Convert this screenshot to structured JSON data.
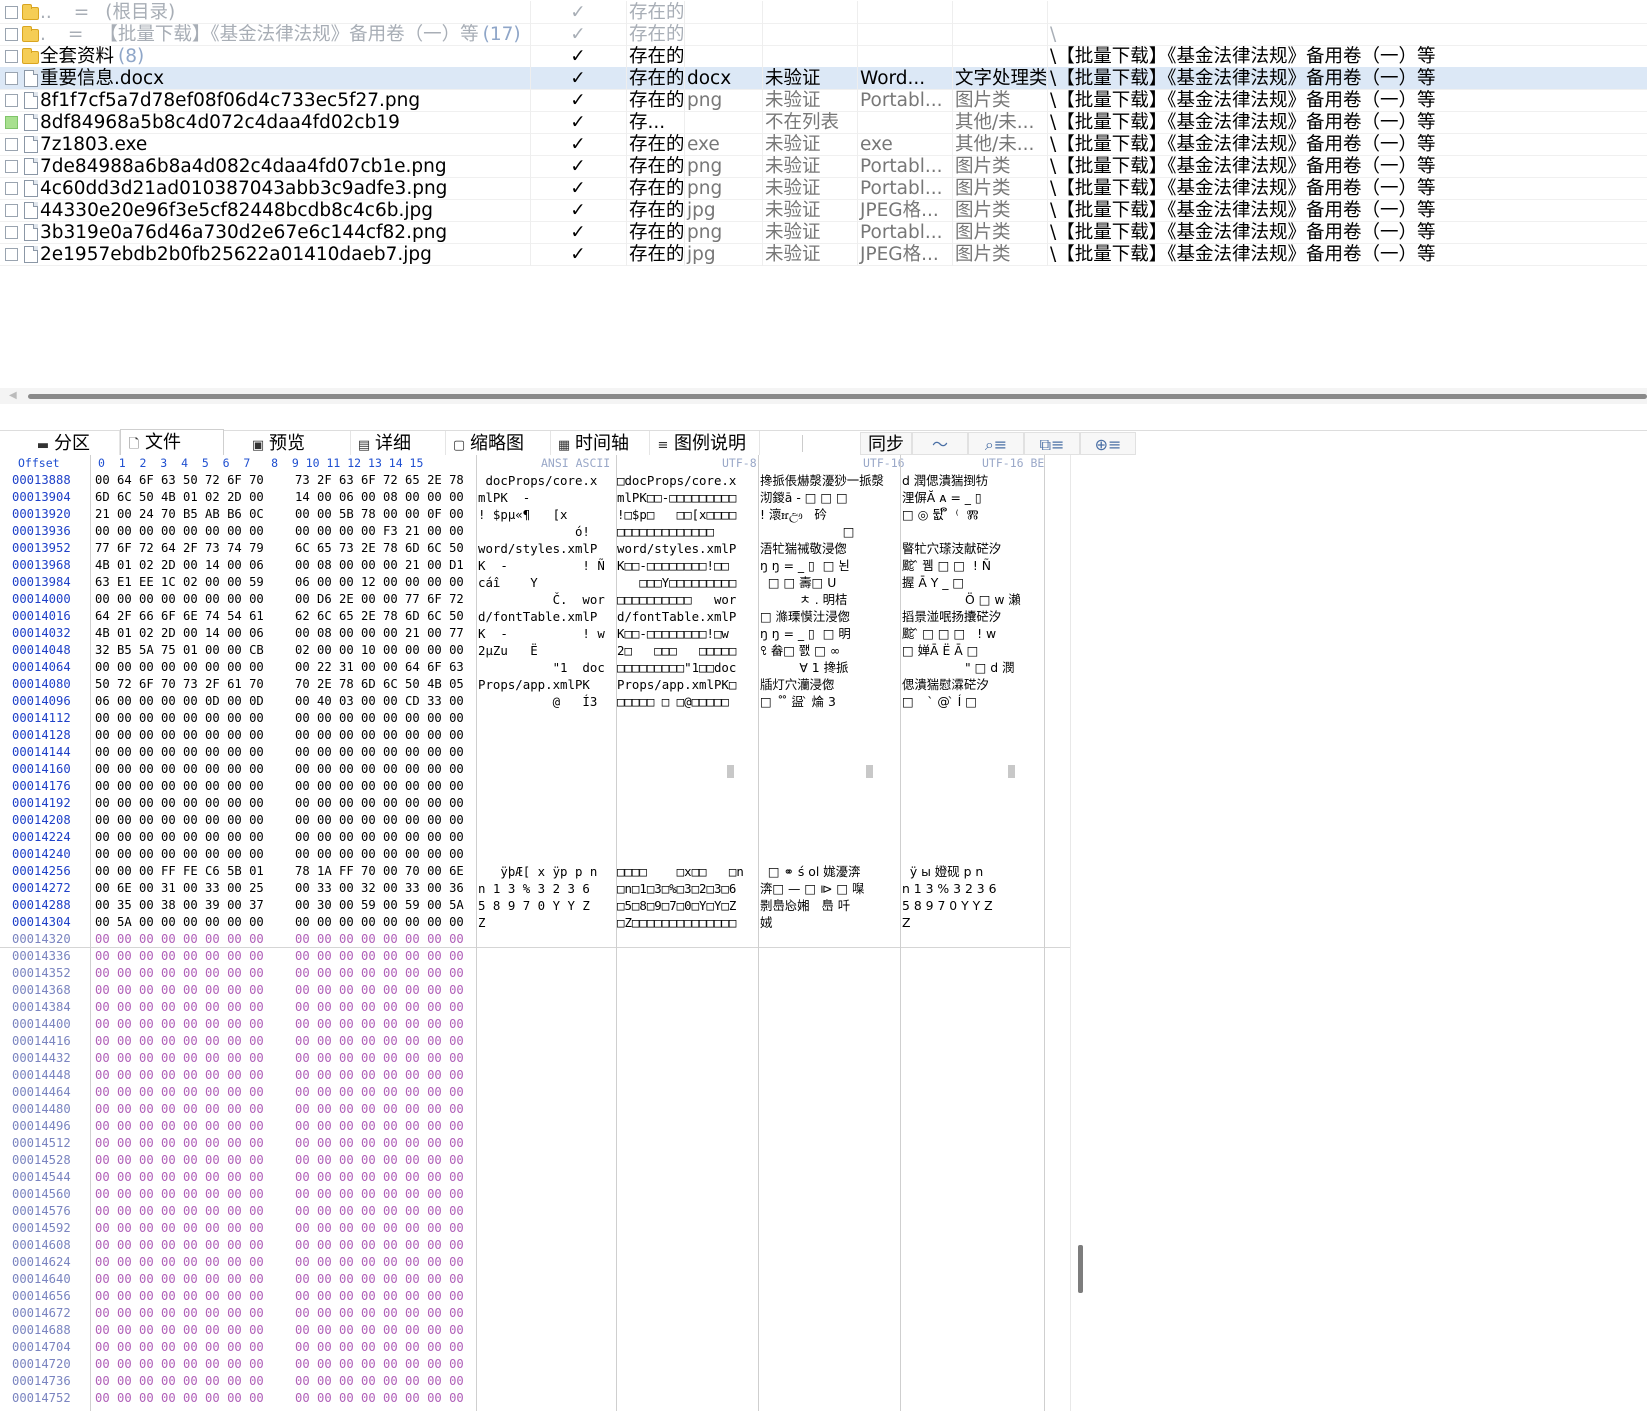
{
  "file_list": {
    "rows": [
      {
        "name": "..",
        "status_sep": "=",
        "name_suffix": "(根目录)",
        "count": "",
        "checked": "✓",
        "status": "存在的",
        "ext": "",
        "sig": "",
        "type": "",
        "category": "",
        "path": "",
        "dim": true,
        "icon": "folder-up"
      },
      {
        "name": ".",
        "status_sep": "=",
        "name_suffix": "【批量下载】《基金法律法规》备用卷（一）等",
        "count": "(17)",
        "checked": "✓",
        "status": "存在的",
        "ext": "",
        "sig": "",
        "type": "",
        "category": "",
        "path": "\\",
        "dim": true,
        "icon": "folder-up"
      },
      {
        "name": "全套资料",
        "status_sep": "",
        "name_suffix": "",
        "count": "(8)",
        "checked": "✓",
        "status": "存在的",
        "ext": "",
        "sig": "",
        "type": "",
        "category": "",
        "path": "\\【批量下载】《基金法律法规》备用卷（一）等",
        "dim": false,
        "icon": "folder"
      },
      {
        "name": "重要信息.docx",
        "status_sep": "",
        "name_suffix": "",
        "count": "",
        "checked": "✓",
        "status": "存在的",
        "ext": "docx",
        "sig": "未验证",
        "type": "Word...",
        "category": "文字处理类",
        "path": "\\【批量下载】《基金法律法规》备用卷（一）等",
        "dim": false,
        "icon": "file",
        "selected": true
      },
      {
        "name": "8f1f7cf5a7d78ef08f06d4c733ec5f27.png",
        "status_sep": "",
        "name_suffix": "",
        "count": "",
        "checked": "✓",
        "status": "存在的",
        "ext": "png",
        "sig": "未验证",
        "type": "Portabl...",
        "category": "图片类",
        "path": "\\【批量下载】《基金法律法规》备用卷（一）等",
        "dim": false,
        "icon": "file"
      },
      {
        "name": "8df84968a5b8c4d072c4daa4fd02cb19",
        "status_sep": "",
        "name_suffix": "",
        "count": "",
        "checked": "✓",
        "status": "存...",
        "ext": "",
        "sig": "不在列表",
        "type": "",
        "category": "其他/未...",
        "path": "\\【批量下载】《基金法律法规》备用卷（一）等",
        "dim": false,
        "icon": "file",
        "green": true
      },
      {
        "name": "7z1803.exe",
        "status_sep": "",
        "name_suffix": "",
        "count": "",
        "checked": "✓",
        "status": "存在的",
        "ext": "exe",
        "sig": "未验证",
        "type": "exe",
        "category": "其他/未...",
        "path": "\\【批量下载】《基金法律法规》备用卷（一）等",
        "dim": false,
        "icon": "file"
      },
      {
        "name": "7de84988a6b8a4d082c4daa4fd07cb1e.png",
        "status_sep": "",
        "name_suffix": "",
        "count": "",
        "checked": "✓",
        "status": "存在的",
        "ext": "png",
        "sig": "未验证",
        "type": "Portabl...",
        "category": "图片类",
        "path": "\\【批量下载】《基金法律法规》备用卷（一）等",
        "dim": false,
        "icon": "file"
      },
      {
        "name": "4c60dd3d21ad010387043abb3c9adfe3.png",
        "status_sep": "",
        "name_suffix": "",
        "count": "",
        "checked": "✓",
        "status": "存在的",
        "ext": "png",
        "sig": "未验证",
        "type": "Portabl...",
        "category": "图片类",
        "path": "\\【批量下载】《基金法律法规》备用卷（一）等",
        "dim": false,
        "icon": "file"
      },
      {
        "name": "44330e20e96f3e5cf82448bcdb8c4c6b.jpg",
        "status_sep": "",
        "name_suffix": "",
        "count": "",
        "checked": "✓",
        "status": "存在的",
        "ext": "jpg",
        "sig": "未验证",
        "type": "JPEG格...",
        "category": "图片类",
        "path": "\\【批量下载】《基金法律法规》备用卷（一）等",
        "dim": false,
        "icon": "file"
      },
      {
        "name": "3b319e0a76d46a730d2e67e6c144cf82.png",
        "status_sep": "",
        "name_suffix": "",
        "count": "",
        "checked": "✓",
        "status": "存在的",
        "ext": "png",
        "sig": "未验证",
        "type": "Portabl...",
        "category": "图片类",
        "path": "\\【批量下载】《基金法律法规》备用卷（一）等",
        "dim": false,
        "icon": "file"
      },
      {
        "name": "2e1957ebdb2b0fb25622a01410daeb7.jpg",
        "status_sep": "",
        "name_suffix": "",
        "count": "",
        "checked": "✓",
        "status": "存在的",
        "ext": "jpg",
        "sig": "未验证",
        "type": "JPEG格...",
        "category": "图片类",
        "path": "\\【批量下载】《基金法律法规》备用卷（一）等",
        "dim": false,
        "icon": "file"
      }
    ]
  },
  "tabs": [
    {
      "id": "partition",
      "label": "分区",
      "icon": "▬"
    },
    {
      "id": "file",
      "label": "文件",
      "icon": "🗋",
      "active": true
    },
    {
      "id": "preview",
      "label": "预览",
      "icon": "▣"
    },
    {
      "id": "details",
      "label": "详细",
      "icon": "▤"
    },
    {
      "id": "thumbnail",
      "label": "缩略图",
      "icon": "▢"
    },
    {
      "id": "timeline",
      "label": "时间轴",
      "icon": "▦"
    },
    {
      "id": "legend",
      "label": "图例说明",
      "icon": "≡"
    }
  ],
  "toolbar": {
    "sync_label": "同步"
  },
  "hex": {
    "header": {
      "offset": "Offset",
      "cols": "0  1  2  3  4  5  6  7   8  9 10 11 12 13 14 15",
      "ansi": "ANSI ASCII",
      "utf8": "UTF-8",
      "utf16": "UTF-16",
      "utf16be": "UTF-16 BE"
    },
    "rows": [
      {
        "off": "00013888",
        "h1": "00 64 6F 63 50 72 6F 70",
        "h2": "73 2F 63 6F 72 65 2E 78",
        "a": " docProps/core.x",
        "u8": "□docProps/core.x",
        "u16": "搀挀倀爀漀瀀猀⼀挀漀",
        "be": "d 潤偲潰猯捯牥⹸"
      },
      {
        "off": "00013904",
        "h1": "6D 6C 50 4B 01 02 2D 00",
        "h2": "14 00 06 00 08 00 00 00",
        "a": "mlPK  -",
        "u8": "mlPK□□-□□□□□□□□□",
        "u16": "沏鍐ā - □ □ □",
        "be": "浬偋Ă ᴀ = _ ▯"
      },
      {
        "off": "00013920",
        "h1": "21 00 24 70 B5 AB B6 0C",
        "h2": "00 00 5B 78 00 00 0F 00",
        "a": "! $pµ«¶   [x",
        "u8": "!□$p□   □□[x□□□□",
        "u16": "! 瀤ꮵඌ   砛",
        "be": "□ ◎ 뒶 ຶ  ⁽  Ⰿ"
      },
      {
        "off": "00013936",
        "h1": "00 00 00 00 00 00 00 00",
        "h2": "00 00 00 00 F3 21 00 00",
        "a": "             ó!",
        "u8": "□□□□□□□□□□□□□",
        "u16": "                     □",
        "be": ""
      },
      {
        "off": "00013952",
        "h1": "77 6F 72 64 2F 73 74 79",
        "h2": "6C 65 73 2E 78 6D 6C 50",
        "a": "word/styles.xmlP",
        "u8": "word/styles.xmlP",
        "u16": "浯牤猯祴敬⹳浸偬",
        "be": "睯牤⽳瑹汥献硭汐"
      },
      {
        "off": "00013968",
        "h1": "4B 01 02 2D 00 14 00 06",
        "h2": "00 08 00 00 00 21 00 D1",
        "a": "K  -          ! Ñ",
        "u8": "K□□-□□□□□□□□!□□",
        "u16": "ŋ ŋ = _ ▯  □ 뇐",
        "be": "䬁 ̂ 뀀 □ □  ! Ñ"
      },
      {
        "off": "00013984",
        "h1": "63 E1 EE 1C 02 00 00 59",
        "h2": "06 00 00 12 00 00 00 00",
        "a": "cáî    Y",
        "u8": "   □□□Y□□□□□□□□□",
        "u16": "  □ □ 壽□ U",
        "be": "握 Ā Y _ □"
      },
      {
        "off": "00014000",
        "h1": "00 00 00 00 00 00 00 00",
        "h2": "00 D6 2E 00 00 77 6F 72",
        "a": "          Č.  wor",
        "u8": "□□□□□□□□□□   wor",
        "u16": "          ㅊ . 明桔",
        "be": "                Ö □ w 瀨"
      },
      {
        "off": "00014016",
        "h1": "64 2F 66 6F 6E 74 54 61",
        "h2": "62 6C 65 2E 78 6D 6C 50",
        "a": "d/fontTable.xmlP",
        "u8": "d/fontTable.xmlP",
        "u16": "□ 滌瑮慔汢⹥浸偬",
        "be": "搯景湴呡扬攮硭汐"
      },
      {
        "off": "00014032",
        "h1": "4B 01 02 2D 00 14 00 06",
        "h2": "00 08 00 00 00 21 00 77",
        "a": "K  -          ! w",
        "u8": "K□□-□□□□□□□□!□w",
        "u16": "ŋ ŋ = _ ▯  □ 明",
        "be": "䬁 ̂ □ □ □   ! w"
      },
      {
        "off": "00014048",
        "h1": "32 B5 5A 75 01 00 00 CB",
        "h2": "02 00 00 10 00 00 00 00",
        "a": "2µZu   Ë",
        "u8": "2□   □□□   □□□□□",
        "u16": "ꘫ 畚□ 쬀 □ ∞",
        "be": "□ 婵Ā Ë Ā □"
      },
      {
        "off": "00014064",
        "h1": "00 00 00 00 00 00 00 00",
        "h2": "00 22 31 00 00 64 6F 63",
        "a": "          \"1  doc",
        "u8": "□□□□□□□□□\"1□□doc",
        "u16": "          ∀ 1 搀挀",
        "be": "                \" □ d 潣"
      },
      {
        "off": "00014080",
        "h1": "50 72 6F 70 73 2F 61 70",
        "h2": "70 2E 78 6D 6C 50 4B 05",
        "a": "Props/app.xmlPK",
        "u8": "Props/app.xmlPK□",
        "u16": "牐灯⽳灡⹰浸偬",
        "be": "偲潰猯慰瀮硭汐"
      },
      {
        "off": "00014096",
        "h1": "06 00 00 00 00 0D 00 0D",
        "h2": "00 40 03 00 00 CD 33 00",
        "a": "          @   Í3",
        "u8": "□□□□□ □ □@□□□□□",
        "u16": "□   ̊ ̊ 䀀 ̀ 㷍 3",
        "be": "□     ̀ @ ̀ Í □"
      },
      {
        "off": "00014112",
        "h1": "00 00 00 00 00 00 00 00",
        "h2": "00 00 00 00 00 00 00 00",
        "a": "",
        "u8": "",
        "u16": "",
        "be": ""
      },
      {
        "off": "00014128",
        "h1": "00 00 00 00 00 00 00 00",
        "h2": "00 00 00 00 00 00 00 00",
        "a": "",
        "u8": "",
        "u16": "",
        "be": ""
      },
      {
        "off": "00014144",
        "h1": "00 00 00 00 00 00 00 00",
        "h2": "00 00 00 00 00 00 00 00",
        "a": "",
        "u8": "",
        "u16": "",
        "be": ""
      },
      {
        "off": "00014160",
        "h1": "00 00 00 00 00 00 00 00",
        "h2": "00 00 00 00 00 00 00 00",
        "a": "",
        "u8": "",
        "u16": "",
        "be": ""
      },
      {
        "off": "00014176",
        "h1": "00 00 00 00 00 00 00 00",
        "h2": "00 00 00 00 00 00 00 00",
        "a": "",
        "u8": "",
        "u16": "",
        "be": ""
      },
      {
        "off": "00014192",
        "h1": "00 00 00 00 00 00 00 00",
        "h2": "00 00 00 00 00 00 00 00",
        "a": "",
        "u8": "",
        "u16": "",
        "be": ""
      },
      {
        "off": "00014208",
        "h1": "00 00 00 00 00 00 00 00",
        "h2": "00 00 00 00 00 00 00 00",
        "a": "",
        "u8": "",
        "u16": "",
        "be": ""
      },
      {
        "off": "00014224",
        "h1": "00 00 00 00 00 00 00 00",
        "h2": "00 00 00 00 00 00 00 00",
        "a": "",
        "u8": "",
        "u16": "",
        "be": ""
      },
      {
        "off": "00014240",
        "h1": "00 00 00 00 00 00 00 00",
        "h2": "00 00 00 00 00 00 00 00",
        "a": "",
        "u8": "",
        "u16": "",
        "be": ""
      },
      {
        "off": "00014256",
        "h1": "00 00 00 FF FE C6 5B 01",
        "h2": "78 1A FF 70 00 70 00 6E",
        "a": "   ÿþÆ[ x ÿp p n",
        "u8": "□□□□    □x□□   □n",
        "u16": "  □ ⚭ ś ol 娏瀀渀",
        "be": "  ÿ ы 嬁砚 p n"
      },
      {
        "off": "00014272",
        "h1": "00 6E 00 31 00 33 00 25",
        "h2": "00 33 00 32 00 33 00 36",
        "a": "n 1 3 % 3 2 3 6",
        "u8": "□n□1□3□%□3□2□3□6",
        "u16": "渀□ — □ ⧐ □ 㘀",
        "be": "n 1 3 % 3 2 3 6"
      },
      {
        "off": "00014288",
        "h1": "00 35 00 38 00 39 00 37",
        "h2": "00 30 00 59 00 59 00 5A",
        "a": "5 8 9 7 0 Y Y Z",
        "u8": "□5□8□9□7□0□Y□Y□Z",
        "u16": "㔀㠀㤀㜀   㠀 吀",
        "be": "5 8 9 7 0 Y Y Z"
      },
      {
        "off": "00014304",
        "h1": "00 5A 00 00 00 00 00 00",
        "h2": "00 00 00 00 00 00 00 00",
        "a": "Z",
        "u8": "□Z□□□□□□□□□□□□□□",
        "u16": "娀",
        "be": "Z"
      },
      {
        "off": "00014320",
        "h1": "00 00 00 00 00 00 00 00",
        "h2": "00 00 00 00 00 00 00 00",
        "a": "",
        "u8": "",
        "u16": "",
        "be": "",
        "pad": true
      }
    ],
    "pad_offsets": [
      "00014336",
      "00014352",
      "00014368",
      "00014384",
      "00014400",
      "00014416",
      "00014432",
      "00014448",
      "00014464",
      "00014480",
      "00014496",
      "00014512",
      "00014528",
      "00014544",
      "00014560",
      "00014576",
      "00014592",
      "00014608",
      "00014624",
      "00014640",
      "00014656",
      "00014672",
      "00014688",
      "00014704",
      "00014720",
      "00014736",
      "00014752"
    ],
    "pad_hex1": "00 00 00 00 00 00 00 00",
    "pad_hex2": "00 00 00 00 00 00 00 00"
  }
}
